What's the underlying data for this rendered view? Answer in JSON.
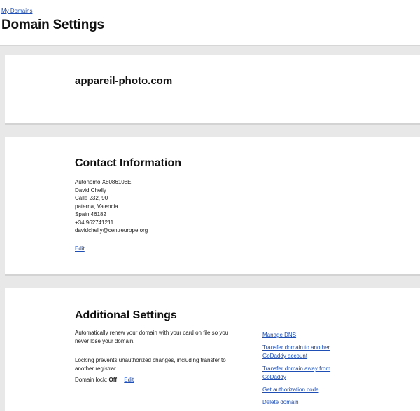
{
  "header": {
    "breadcrumb": "My Domains",
    "title": "Domain Settings"
  },
  "domain": {
    "name": "appareil-photo.com"
  },
  "contact": {
    "title": "Contact Information",
    "lines": [
      "Autonomo X8086108E",
      "David Chelly",
      "Calle 232, 90",
      "paterna, Valencia",
      "Spain 46182",
      "+34.962741211",
      "davidchelly@centreurope.org"
    ],
    "edit_label": "Edit"
  },
  "additional": {
    "title": "Additional Settings",
    "auto_renew_text": "Automatically renew your domain with your card on file so you never lose your domain.",
    "lock_text": "Locking prevents unauthorized changes, including transfer to another registrar.",
    "lock_label": "Domain lock:",
    "lock_value": "Off",
    "lock_edit_label": "Edit",
    "actions": [
      "Manage DNS",
      "Transfer domain to another GoDaddy account",
      "Transfer domain away from GoDaddy",
      "Get authorization code",
      "Delete domain"
    ]
  }
}
